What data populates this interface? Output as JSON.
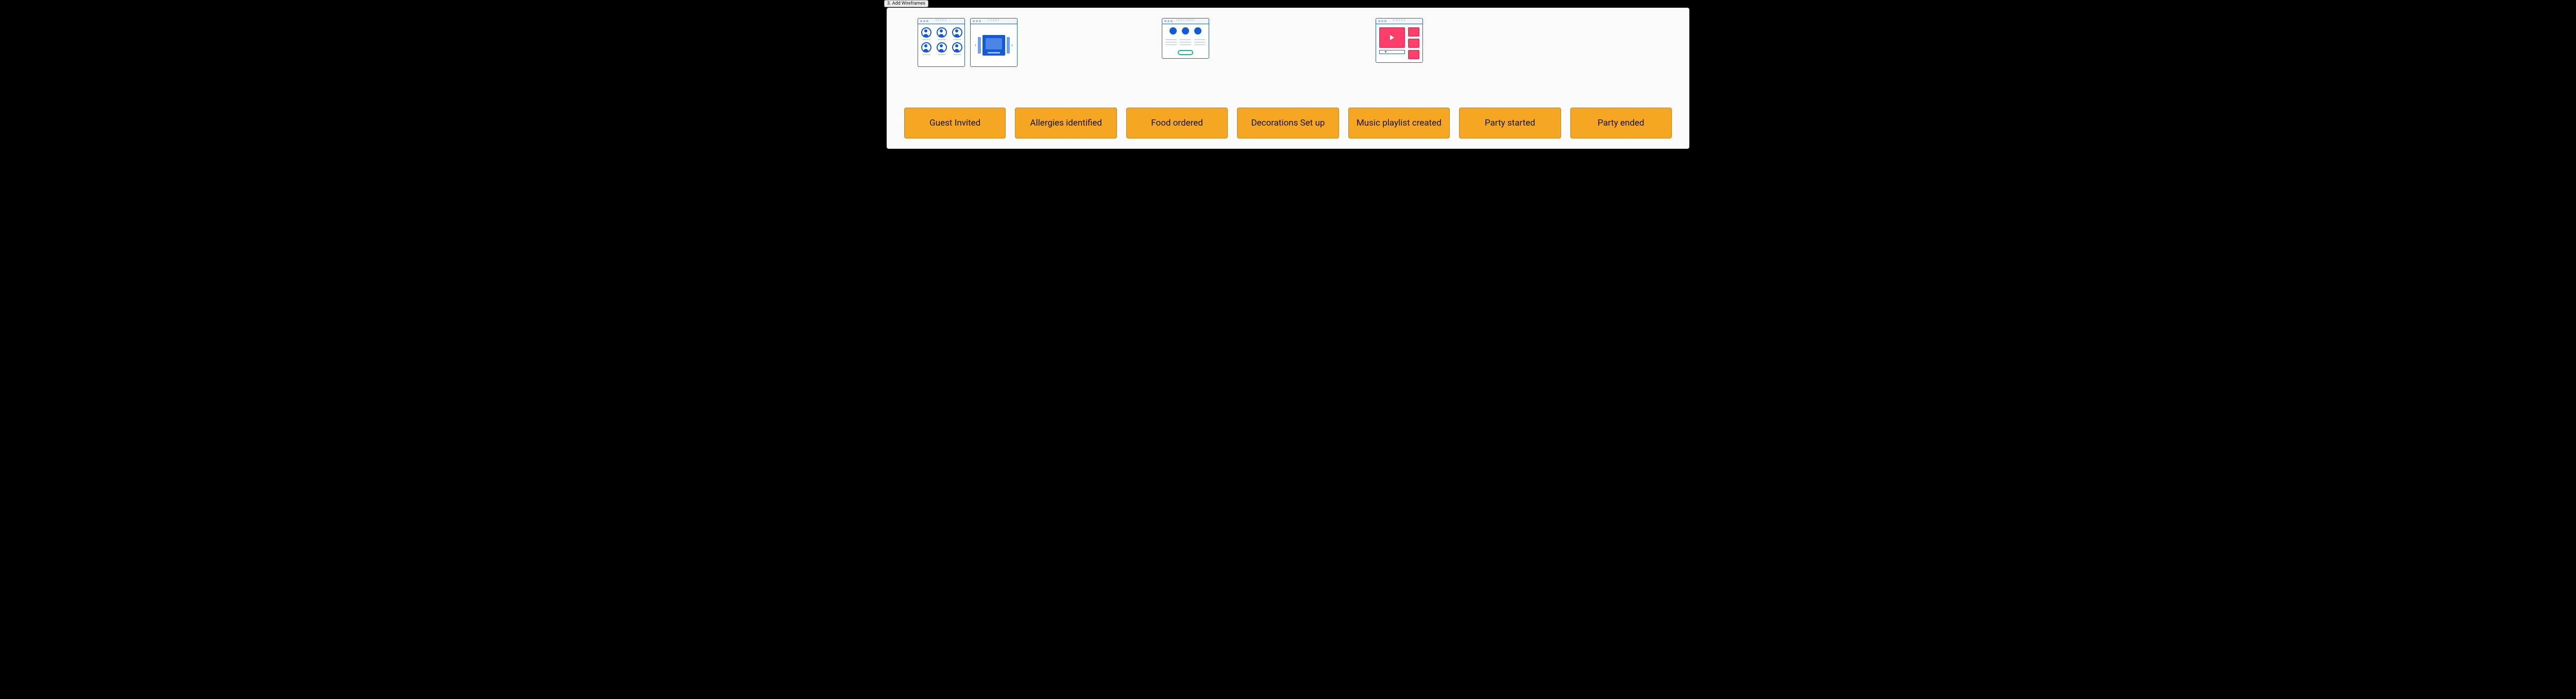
{
  "tab_label": "3. Add Wireframes",
  "wireframes": {
    "users_title": "USERS",
    "cards_title": "CARDS",
    "features_title": "FEATURES",
    "videos_title": "VIDEOS"
  },
  "steps": [
    "Guest Invited",
    "Allergies identified",
    "Food ordered",
    "Decorations Set up",
    "Music playlist created",
    "Party started",
    "Party ended"
  ],
  "colors": {
    "step_fill": "#f5a623",
    "step_border": "#c9851b",
    "wireframe_stroke": "#2b5fb7",
    "wireframe_blue": "#1459d6",
    "wireframe_pink": "#ff3e6b",
    "wireframe_teal": "#0fbf9b"
  }
}
